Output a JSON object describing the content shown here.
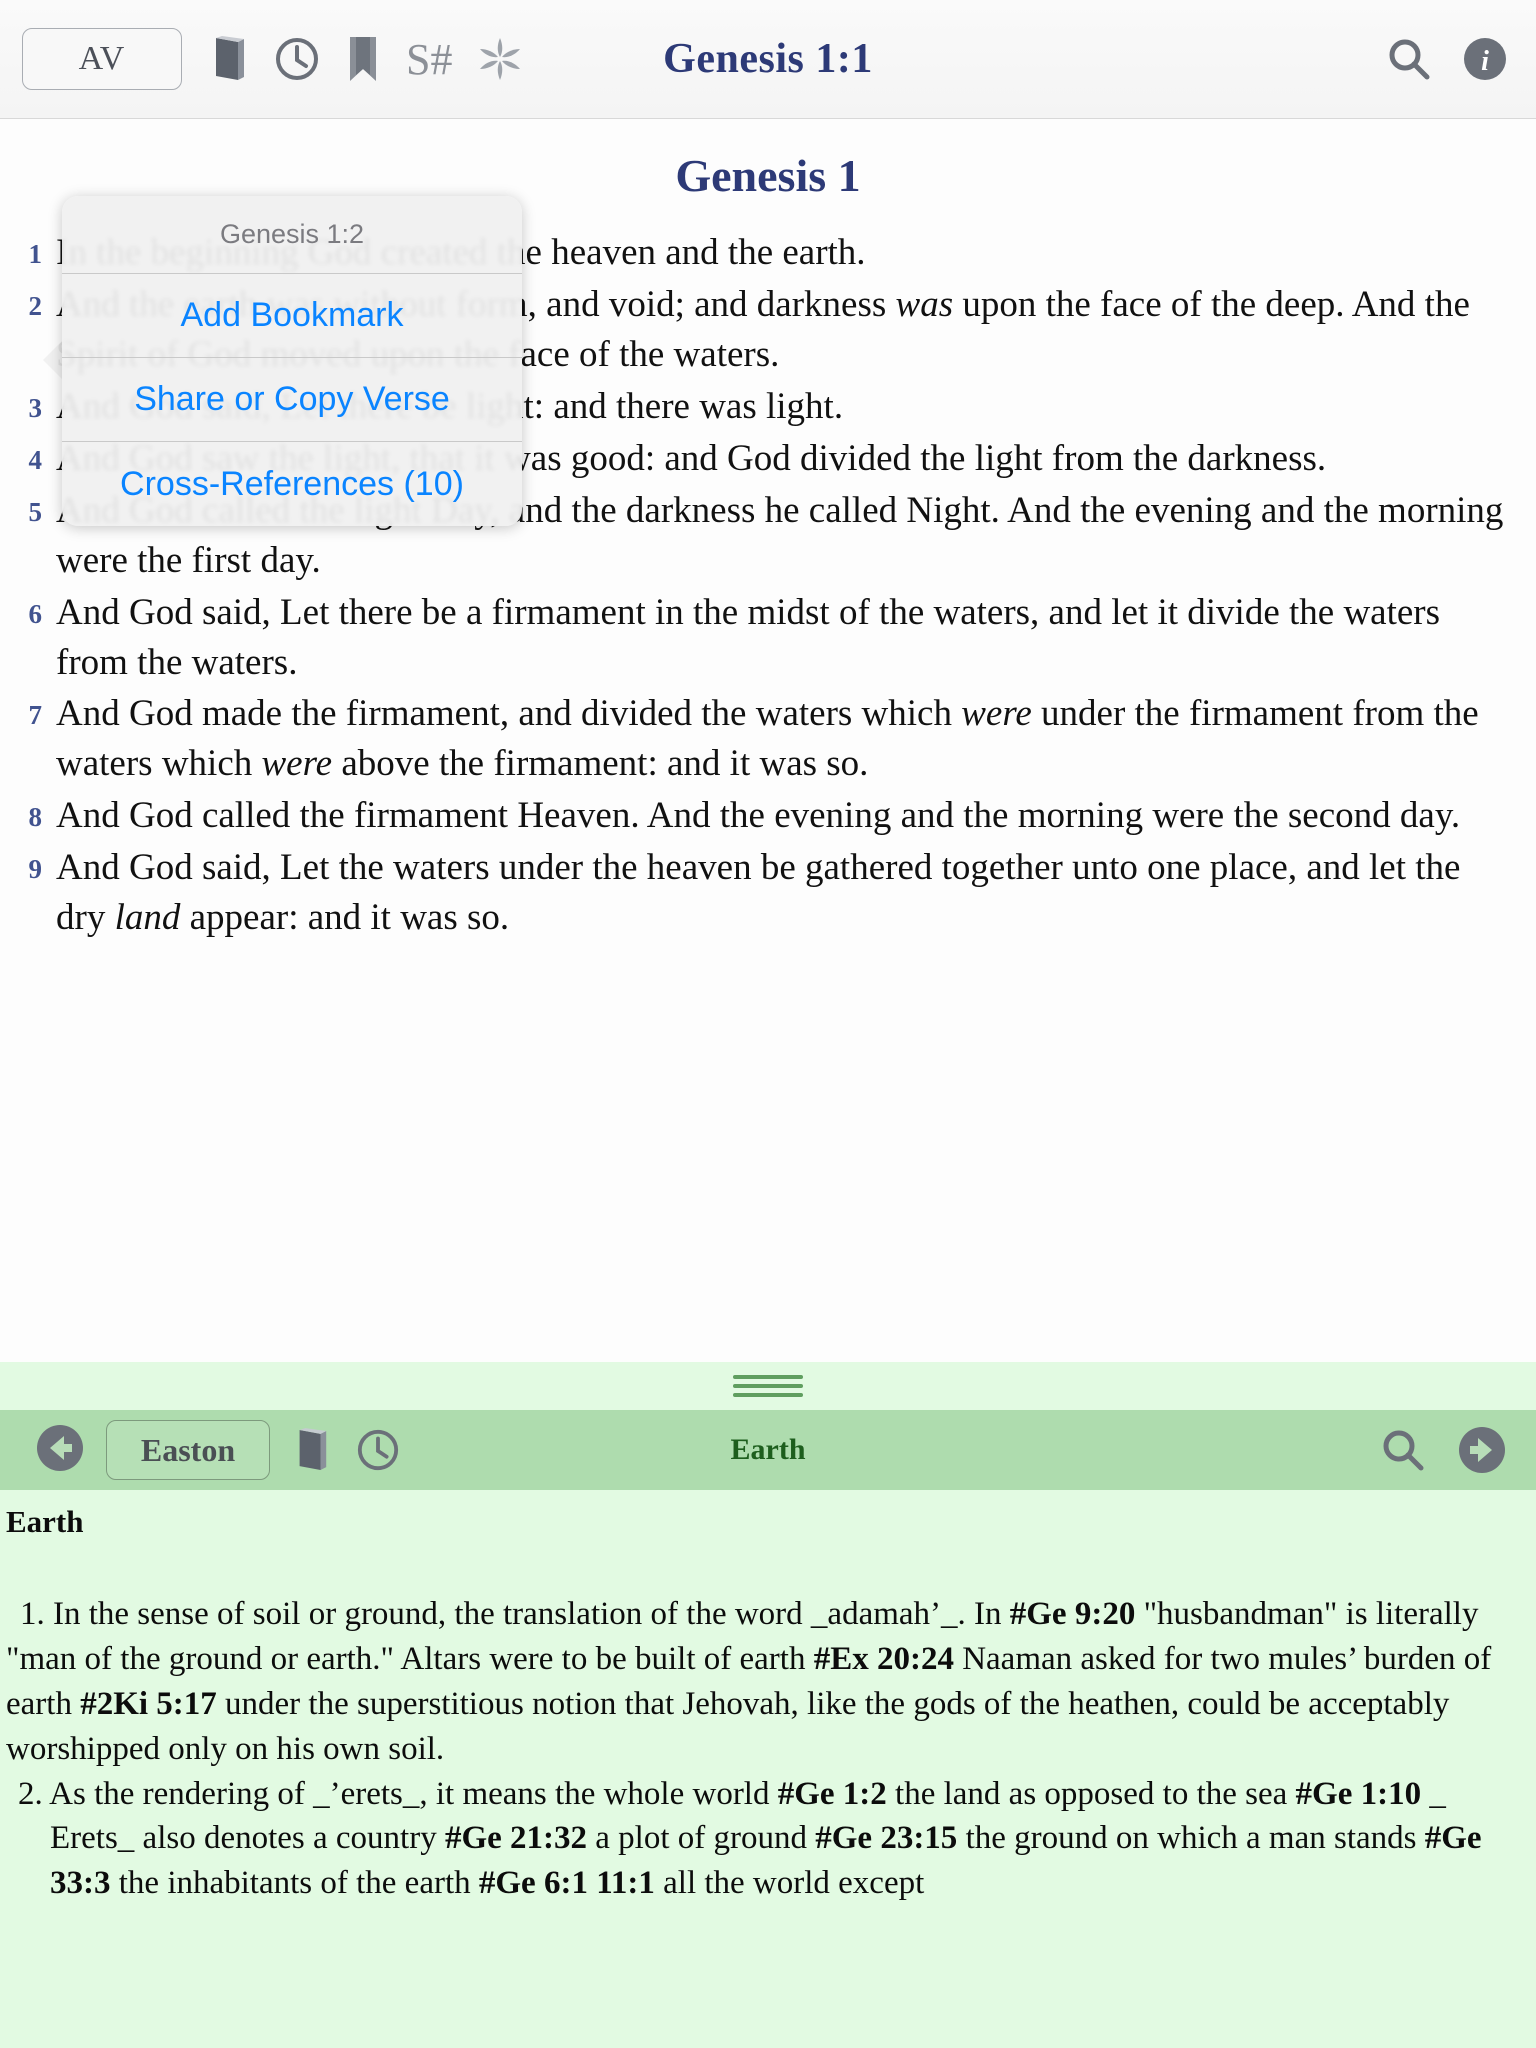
{
  "bible": {
    "toolbar": {
      "translation_button": "AV",
      "title": "Genesis 1:1",
      "icons": {
        "book": "book-icon",
        "clock": "history-clock-icon",
        "bookmark": "bookmark-icon",
        "strongs": "S#",
        "asterisk": "sunburst-asterisk-icon",
        "search": "search-icon",
        "info": "info-icon"
      }
    },
    "chapter_title": "Genesis 1",
    "verses": [
      {
        "num": "1",
        "text": "In the beginning God created the heaven and the earth."
      },
      {
        "num": "2",
        "text_a": "And the earth was without form, and void; and darkness ",
        "italic_a": "was",
        "text_b": " upon the face of the deep. And the Spirit of God moved upon the face of the waters."
      },
      {
        "num": "3",
        "text": "And God said, Let there be light: and there was light."
      },
      {
        "num": "4",
        "text": "And God saw the light, that it was good: and God divided the light from the darkness."
      },
      {
        "num": "5",
        "text": "And God called the light Day, and the darkness he called Night. And the evening and the morning were the first day."
      },
      {
        "num": "6",
        "text": "And God said, Let there be a firmament in the midst of the waters, and let it divide the waters from the waters."
      },
      {
        "num": "7",
        "text_a": "And God made the firmament, and divided the waters which ",
        "italic_a": "were",
        "text_b": " under the firmament from the waters which ",
        "italic_b": "were",
        "text_c": " above the firmament: and it was so."
      },
      {
        "num": "8",
        "text": "And God called the firmament Heaven. And the evening and the morning were the second day."
      },
      {
        "num": "9",
        "text_a": "And God said, Let the waters under the heaven be gathered together unto one place, and let the dry ",
        "italic_a": "land",
        "text_b": " appear: and it was so."
      }
    ]
  },
  "popover": {
    "header": "Genesis 1:2",
    "items": [
      {
        "label": "Add Bookmark"
      },
      {
        "label": "Share or Copy Verse"
      },
      {
        "label": "Cross-References (10)"
      }
    ]
  },
  "dictionary": {
    "toolbar": {
      "back": "back-arrow-icon",
      "source_button": "Easton",
      "icons": {
        "book": "book-icon",
        "clock": "history-clock-icon",
        "search": "search-icon",
        "forward": "forward-arrow-icon"
      },
      "title": "Earth"
    },
    "entry_heading": "Earth",
    "paragraphs": [
      {
        "parts": [
          {
            "t": "1. In the sense of soil or ground, the translation of the word _adamah’_. In ",
            "b": false
          },
          {
            "t": "#Ge 9:20",
            "b": true
          },
          {
            "t": " \"husbandman\" is literally \"man of the ground or earth.\" Altars were to be built of earth ",
            "b": false
          },
          {
            "t": "#Ex 20:24",
            "b": true
          },
          {
            "t": " Naaman asked for two mules’ burden of earth ",
            "b": false
          },
          {
            "t": "#2Ki 5:17",
            "b": true
          },
          {
            "t": " under the superstitious notion that Jehovah, like the gods of the heathen, could be acceptably worshipped only on his own soil.",
            "b": false
          }
        ]
      },
      {
        "parts": [
          {
            "t": "2. As the rendering of _’erets_, it means the whole world ",
            "b": false
          },
          {
            "t": "#Ge 1:2",
            "b": true
          },
          {
            "t": " the land as opposed to the sea ",
            "b": false
          },
          {
            "t": "#Ge 1:10",
            "b": true
          },
          {
            "t": " _ Erets_ also denotes a country ",
            "b": false
          },
          {
            "t": "#Ge 21:32",
            "b": true
          },
          {
            "t": " a plot of ground ",
            "b": false
          },
          {
            "t": "#Ge 23:15",
            "b": true
          },
          {
            "t": " the ground on which a man stands ",
            "b": false
          },
          {
            "t": "#Ge 33:3",
            "b": true
          },
          {
            "t": " the inhabitants of the earth ",
            "b": false
          },
          {
            "t": "#Ge 6:1 11:1",
            "b": true
          },
          {
            "t": " all the world except",
            "b": false
          }
        ]
      }
    ]
  },
  "colors": {
    "bible_title": "#2d3a77",
    "verse_number": "#41538f",
    "popover_action": "#0a84ff",
    "dict_toolbar_bg": "#aedcae",
    "dict_body_bg": "#e2fae2",
    "dict_title": "#1d5e1d",
    "icon_gray": "#6b7079"
  }
}
